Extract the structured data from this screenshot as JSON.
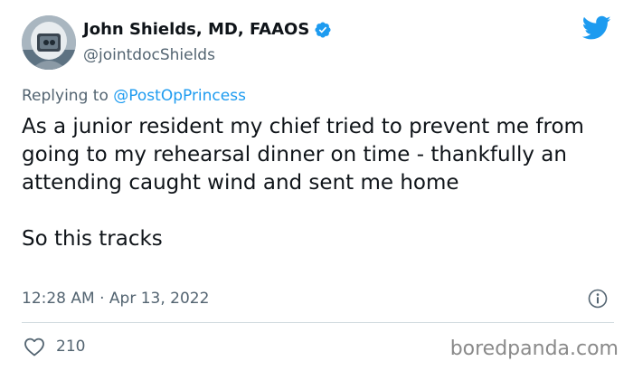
{
  "author": {
    "display_name": "John Shields, MD, FAAOS",
    "handle": "@jointdocShields",
    "verified": true,
    "avatar_icon": "person-in-surgical-helmet-avatar"
  },
  "reply": {
    "prefix": "Replying to ",
    "target": "@PostOpPrincess"
  },
  "tweet": {
    "paragraph_1": "As a junior resident my chief tried to prevent me from going to my rehearsal dinner on time - thankfully an attending caught wind and sent me home",
    "paragraph_2": "So this tracks"
  },
  "meta": {
    "timestamp": "12:28 AM · Apr 13, 2022"
  },
  "engagement": {
    "likes": "210"
  },
  "watermark": "boredpanda.com",
  "colors": {
    "twitter_blue": "#1d9bf0",
    "secondary_text": "#536471",
    "primary_text": "#0f1419",
    "divider": "#cfd9de"
  },
  "icons": {
    "logo": "twitter-bird-icon",
    "verified": "verified-badge-icon",
    "info": "info-icon",
    "like": "heart-icon"
  }
}
